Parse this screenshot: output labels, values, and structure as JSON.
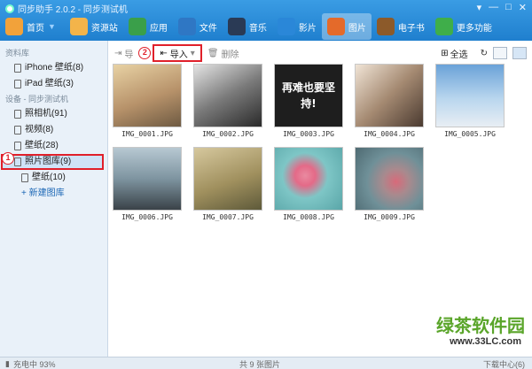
{
  "app": {
    "title": "同步助手 2.0.2 - 同步测试机"
  },
  "window_controls": [
    "▾",
    "—",
    "□",
    "✕"
  ],
  "nav": [
    {
      "label": "首页",
      "icon": "home-icon",
      "color": "#f2a23a"
    },
    {
      "label": "资源站",
      "icon": "gift-icon",
      "color": "#f3b44a"
    },
    {
      "label": "应用",
      "icon": "apps-icon",
      "color": "#3a9f4a"
    },
    {
      "label": "文件",
      "icon": "folder-icon",
      "color": "#2f77c4"
    },
    {
      "label": "音乐",
      "icon": "music-icon",
      "color": "#2a3a55"
    },
    {
      "label": "影片",
      "icon": "video-icon",
      "color": "#2a87d8"
    },
    {
      "label": "图片",
      "icon": "picture-icon",
      "color": "#e46a2a",
      "active": true
    },
    {
      "label": "电子书",
      "icon": "book-icon",
      "color": "#8c5a2a"
    },
    {
      "label": "更多功能",
      "icon": "more-icon",
      "color": "#3fae4a"
    }
  ],
  "sidebar": {
    "library_header": "资料库",
    "library_items": [
      "iPhone 壁纸(8)",
      "iPad 壁纸(3)"
    ],
    "device_header": "设备 - 同步测试机",
    "device_items": [
      "照相机(91)",
      "视频(8)",
      "壁纸(28)",
      "照片图库(9)"
    ],
    "sub_items": [
      "壁纸(10)"
    ],
    "add_label": "+ 新建图库"
  },
  "markers": {
    "one": "1",
    "two": "2"
  },
  "toolbar": {
    "export_label": "导",
    "import_label": "导入",
    "delete_label": "删除",
    "select_all_label": "全选"
  },
  "photos": [
    {
      "name": "IMG_0001.JPG",
      "color": "#c7a57a"
    },
    {
      "name": "IMG_0002.JPG",
      "color": "#6d6d6d"
    },
    {
      "name": "IMG_0003.JPG",
      "color": "#2a2a2a"
    },
    {
      "name": "IMG_0004.JPG",
      "color": "#b89a7e"
    },
    {
      "name": "IMG_0005.JPG",
      "color": "#4a86c2"
    },
    {
      "name": "IMG_0006.JPG",
      "color": "#8fa8b8"
    },
    {
      "name": "IMG_0007.JPG",
      "color": "#a8956a"
    },
    {
      "name": "IMG_0008.JPG",
      "color": "#6fb2b2"
    },
    {
      "name": "IMG_0009.JPG",
      "color": "#7c98a2"
    }
  ],
  "overlay_text": "再难也要坚持!",
  "status": {
    "charging": "充电中 93%",
    "count": "共 9 张图片",
    "download": "下载中心(6)"
  },
  "watermark": {
    "text": "绿茶软件园",
    "url": "www.33LC.com"
  }
}
